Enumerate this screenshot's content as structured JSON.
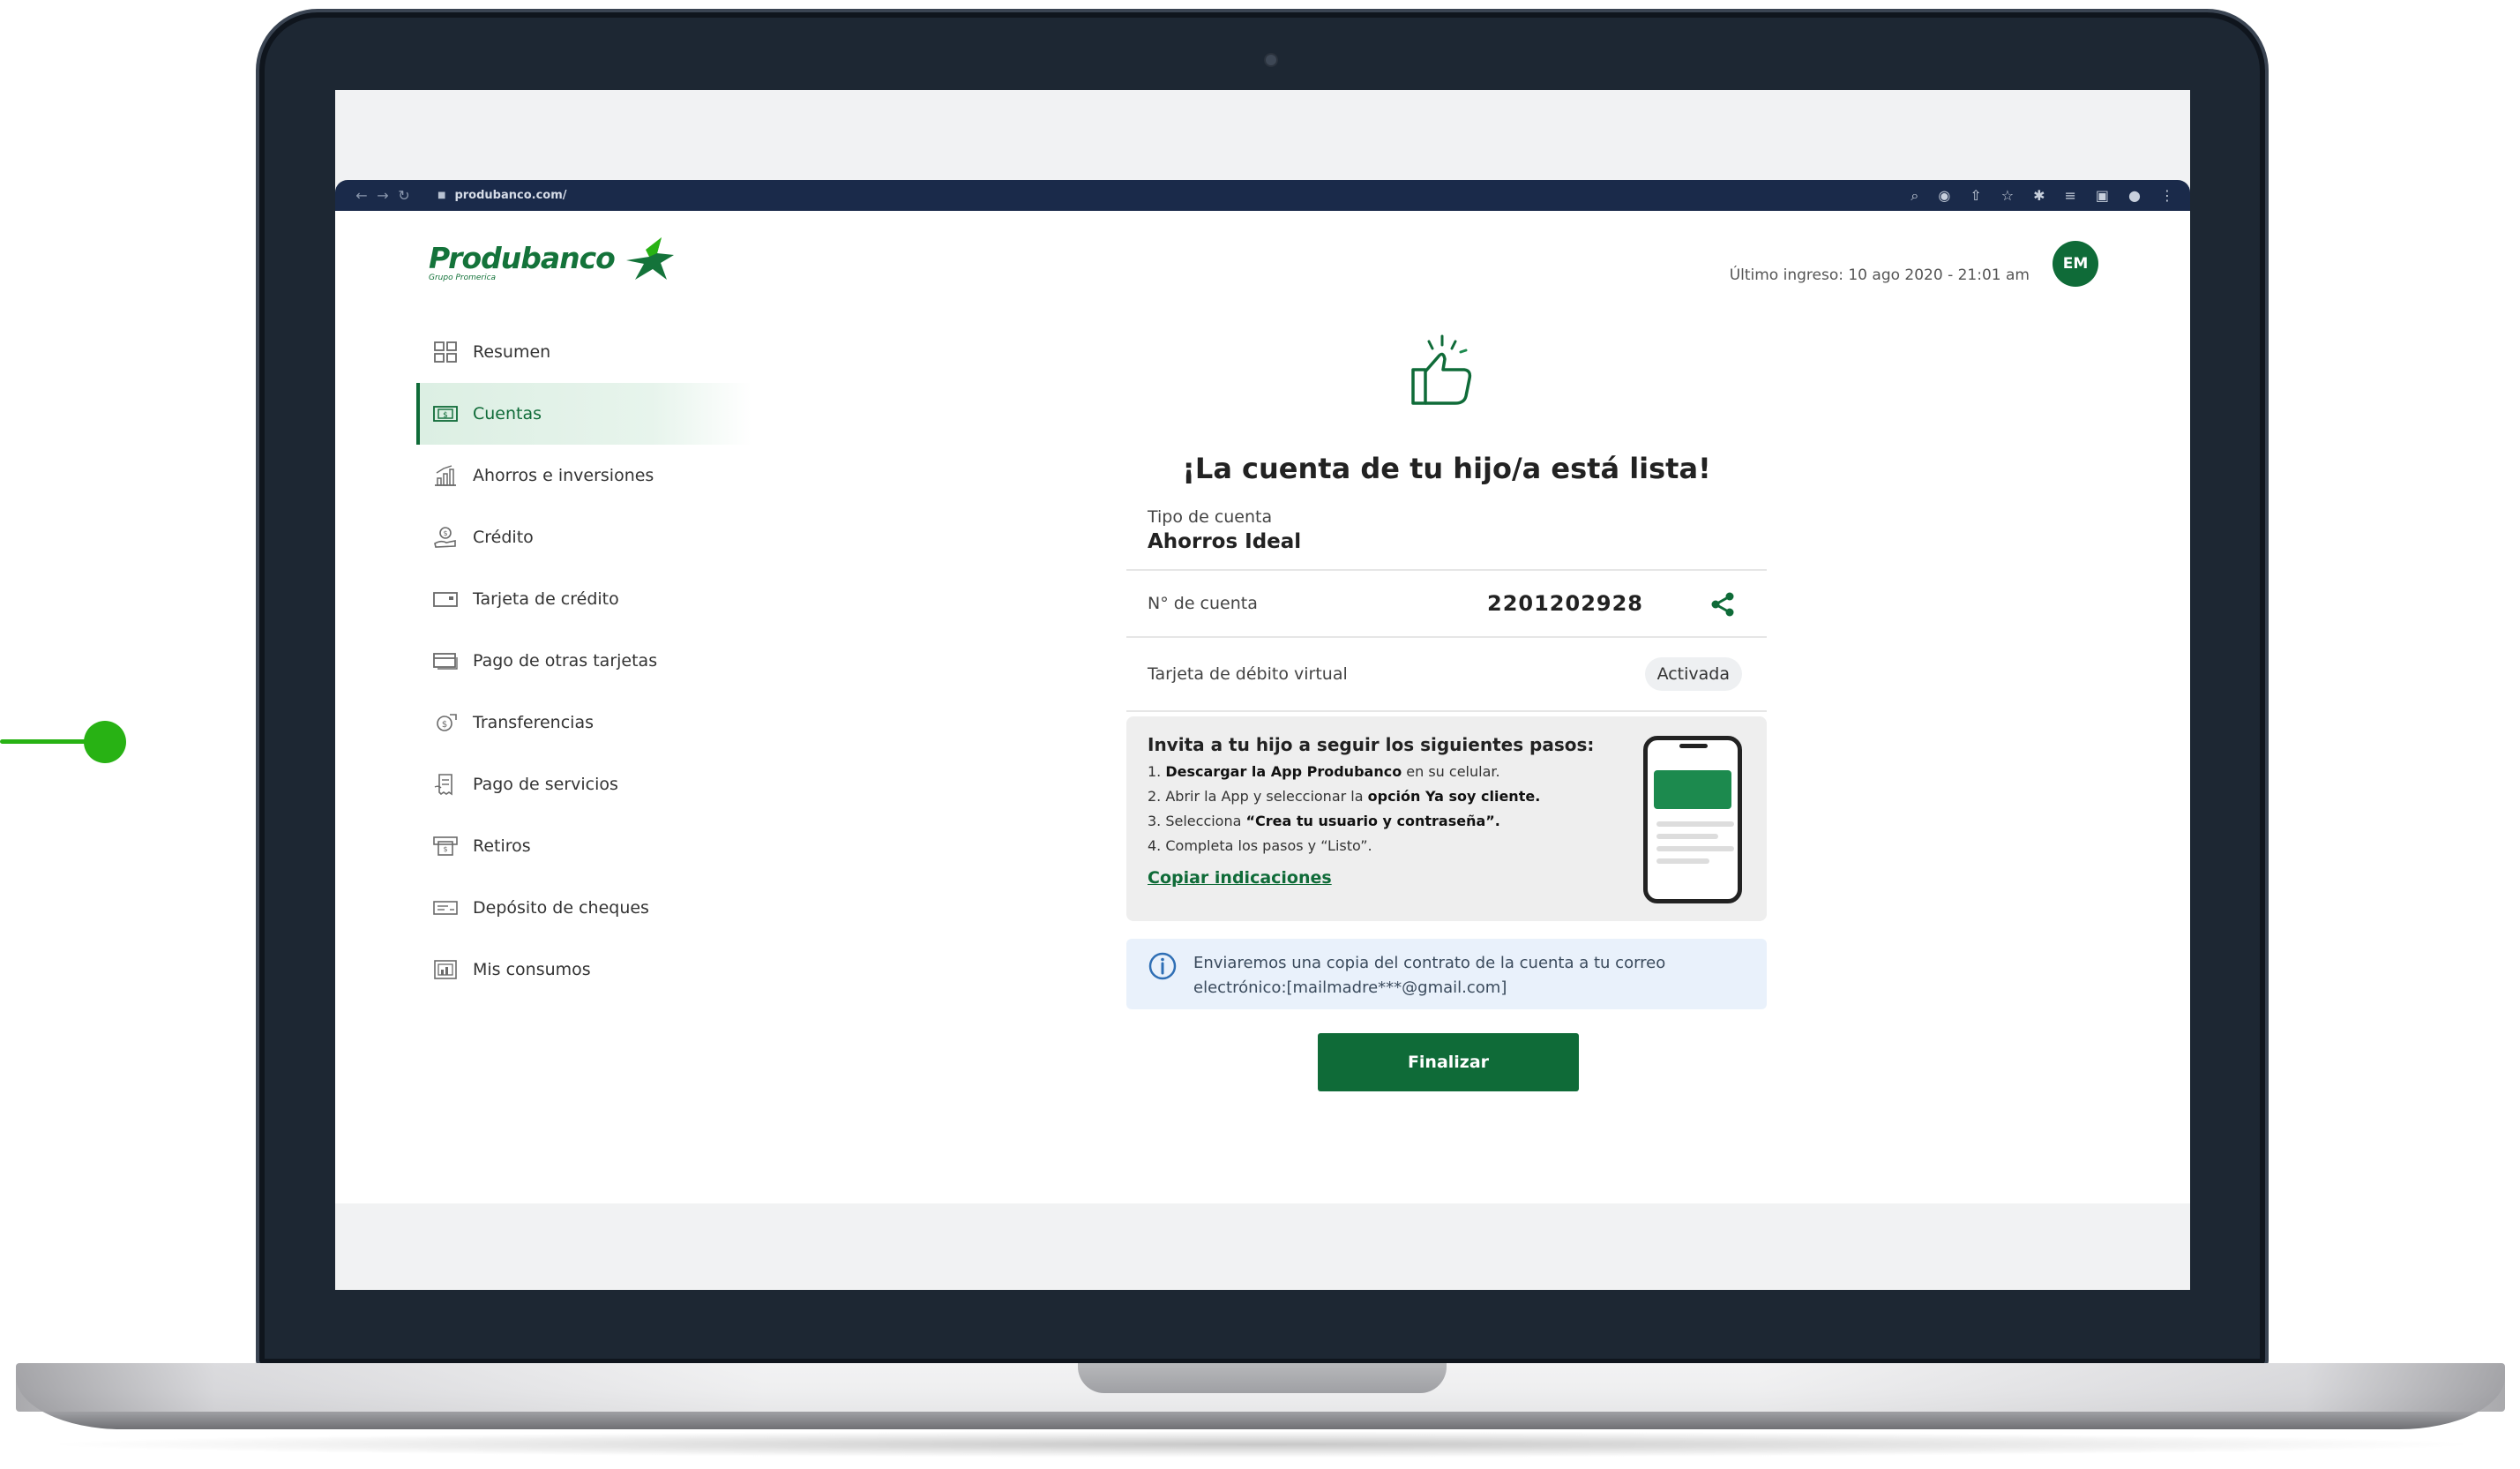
{
  "browser": {
    "url": "produbanco.com/"
  },
  "header": {
    "logo_text": "Produbanco",
    "logo_subtext": "Grupo Promerica",
    "last_login": "Último ingreso: 10 ago 2020 - 21:01 am",
    "avatar_initials": "EM"
  },
  "sidebar": {
    "items": [
      {
        "label": "Resumen",
        "icon": "grid-icon"
      },
      {
        "label": "Cuentas",
        "icon": "money-icon",
        "active": true
      },
      {
        "label": "Ahorros e inversiones",
        "icon": "bar-chart-icon"
      },
      {
        "label": "Crédito",
        "icon": "hand-coin-icon"
      },
      {
        "label": "Tarjeta de crédito",
        "icon": "credit-card-icon"
      },
      {
        "label": "Pago de otras tarjetas",
        "icon": "cards-icon"
      },
      {
        "label": "Transferencias",
        "icon": "transfer-icon"
      },
      {
        "label": "Pago de servicios",
        "icon": "receipt-icon"
      },
      {
        "label": "Retiros",
        "icon": "atm-icon"
      },
      {
        "label": "Depósito de cheques",
        "icon": "check-icon"
      },
      {
        "label": "Mis consumos",
        "icon": "report-icon"
      }
    ]
  },
  "main": {
    "title": "¡La cuenta de tu hijo/a está lista!",
    "account_type_label": "Tipo de cuenta",
    "account_type_value": "Ahorros Ideal",
    "account_number_label": "N° de cuenta",
    "account_number_value": "2201202928",
    "debit_card_label": "Tarjeta de débito virtual",
    "debit_card_status": "Activada",
    "steps": {
      "title": "Invita a tu hijo a seguir los siguientes pasos:",
      "step1_prefix": "1. ",
      "step1_bold": "Descargar la App Produbanco",
      "step1_rest": " en su celular.",
      "step2_prefix": "2. Abrir la App y seleccionar la ",
      "step2_bold": "opción Ya soy cliente.",
      "step3_prefix": "3. Selecciona ",
      "step3_bold": "“Crea tu usuario y contraseña”.",
      "step4": "4. Completa los pasos y “Listo”.",
      "copy_link": "Copiar indicaciones"
    },
    "info_text": "Enviaremos una copia del contrato de la cuenta a tu correo electrónico:[mailmadre***@gmail.com]",
    "finish_button": "Finalizar"
  },
  "colors": {
    "brand_green": "#0f6b38",
    "accent_green": "#28b214",
    "browser_bar": "#1a2a4a"
  }
}
